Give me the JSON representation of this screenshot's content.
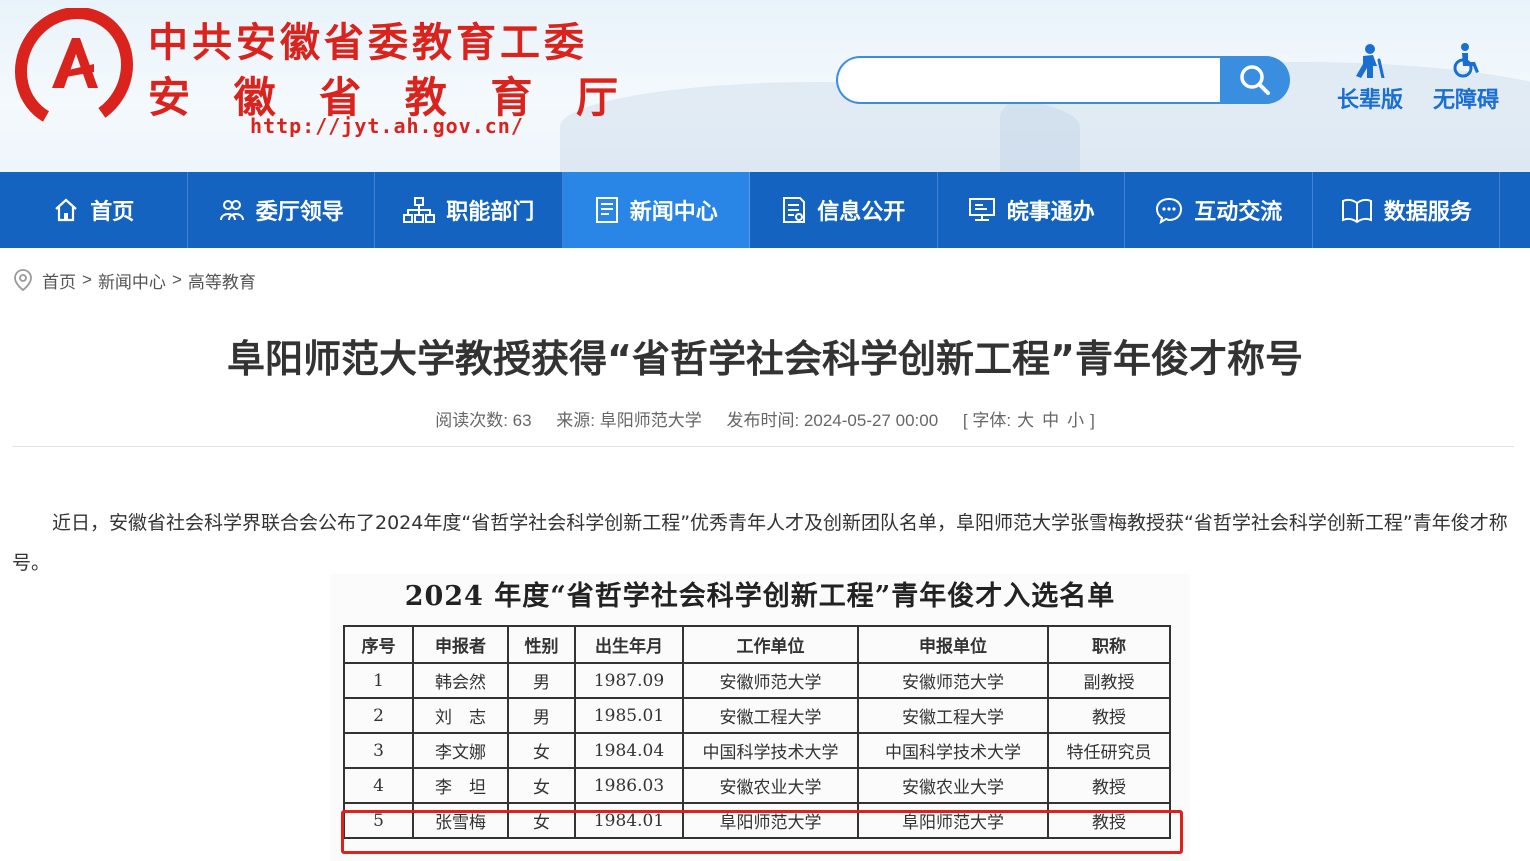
{
  "site": {
    "title_line1": "中共安徽省委教育工委",
    "title_line2_chars": [
      "安",
      "徽",
      "省",
      "教",
      "育",
      "厅"
    ],
    "url": "http://jyt.ah.gov.cn/"
  },
  "search": {
    "placeholder": "",
    "value": ""
  },
  "tools": {
    "elderly": "长辈版",
    "accessible": "无障碍"
  },
  "nav": [
    {
      "label": "首页",
      "icon": "home-icon"
    },
    {
      "label": "委厅领导",
      "icon": "leaders-icon"
    },
    {
      "label": "职能部门",
      "icon": "org-chart-icon"
    },
    {
      "label": "新闻中心",
      "icon": "news-icon",
      "active": true
    },
    {
      "label": "信息公开",
      "icon": "document-icon"
    },
    {
      "label": "皖事通办",
      "icon": "monitor-icon"
    },
    {
      "label": "互动交流",
      "icon": "chat-icon"
    },
    {
      "label": "数据服务",
      "icon": "book-icon"
    }
  ],
  "breadcrumb": [
    "首页",
    "新闻中心",
    "高等教育"
  ],
  "breadcrumb_sep": ">",
  "article": {
    "title": "阜阳师范大学教授获得“省哲学社会科学创新工程”青年俊才称号",
    "meta": {
      "views": "阅读次数: 63",
      "source": "来源: 阜阳师范大学",
      "time": "发布时间: 2024-05-27 00:00",
      "font_open": "[ 字体:",
      "font_large": "大",
      "font_medium": "中",
      "font_small": "小",
      "font_close": "]"
    },
    "paragraph": "近日，安徽省社会科学界联合会公布了2024年度“省哲学社会科学创新工程”优秀青年人才及创新团队名单，阜阳师范大学张雪梅教授获“省哲学社会科学创新工程”青年俊才称号。"
  },
  "figure": {
    "title": "2024 年度“省哲学社会科学创新工程”青年俊才入选名单",
    "headers": [
      "序号",
      "申报者",
      "性别",
      "出生年月",
      "工作单位",
      "申报单位",
      "职称"
    ],
    "rows": [
      [
        "1",
        "韩会然",
        "男",
        "1987.09",
        "安徽师范大学",
        "安徽师范大学",
        "副教授"
      ],
      [
        "2",
        "刘　志",
        "男",
        "1985.01",
        "安徽工程大学",
        "安徽工程大学",
        "教授"
      ],
      [
        "3",
        "李文娜",
        "女",
        "1984.04",
        "中国科学技术大学",
        "中国科学技术大学",
        "特任研究员"
      ],
      [
        "4",
        "李　坦",
        "女",
        "1986.03",
        "安徽农业大学",
        "安徽农业大学",
        "教授"
      ],
      [
        "5",
        "张雪梅",
        "女",
        "1984.01",
        "阜阳师范大学",
        "阜阳师范大学",
        "教授"
      ]
    ],
    "highlight_color": "#e0201b"
  },
  "colors": {
    "brand_red": "#d9231c",
    "nav_blue": "#1463c0",
    "nav_active": "#2a86e6",
    "accent_blue": "#1a6fd1"
  }
}
